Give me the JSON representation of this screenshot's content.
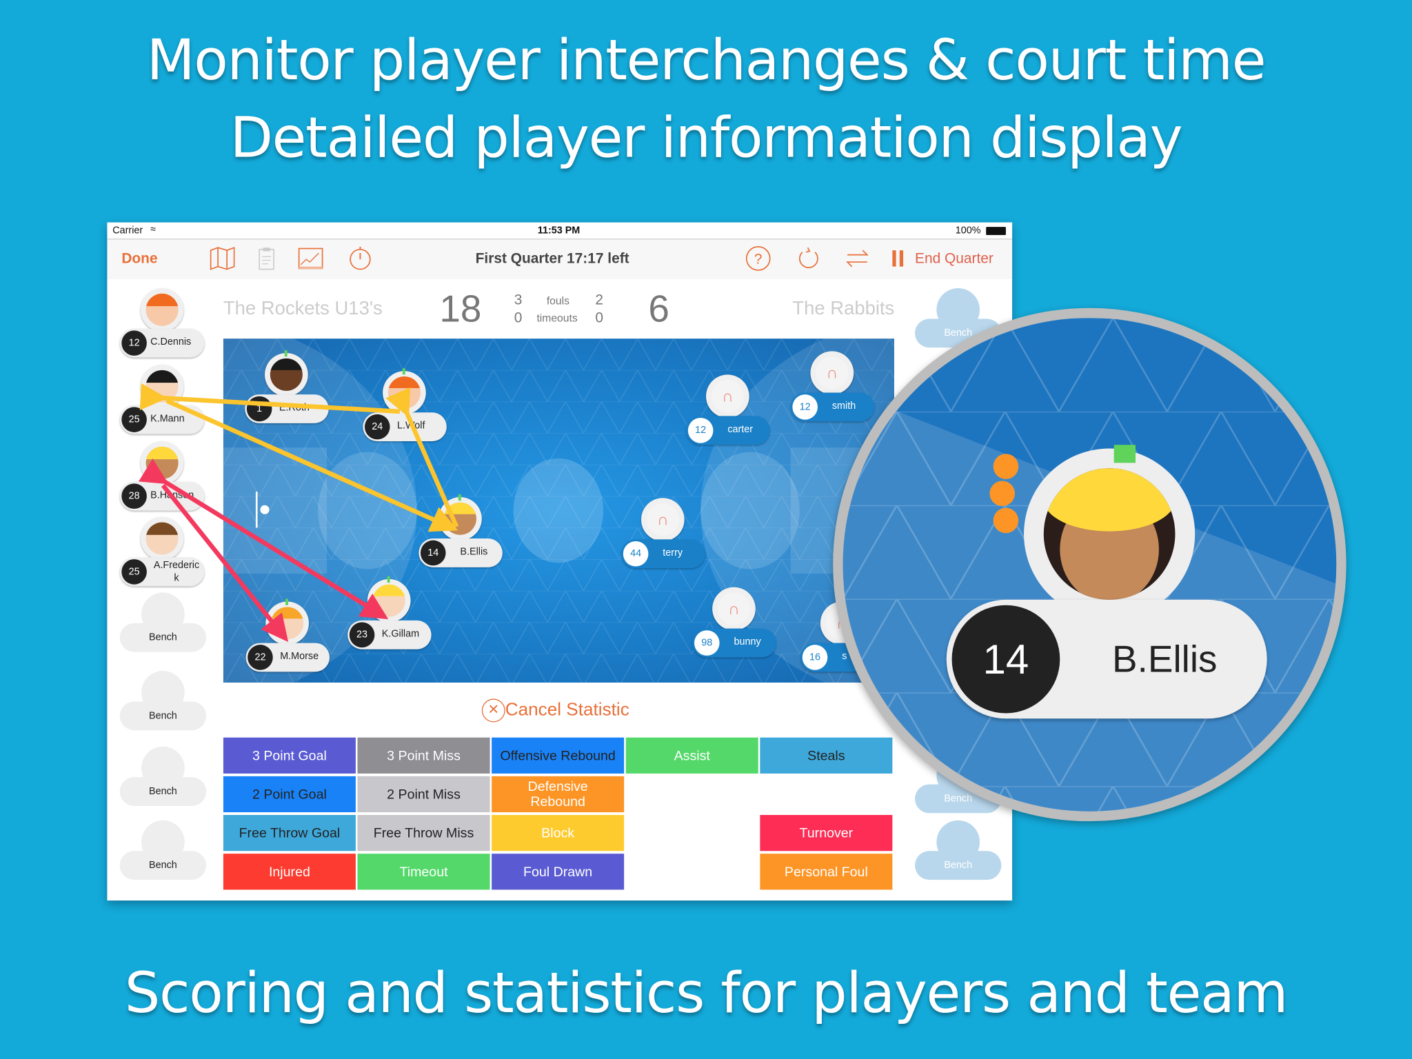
{
  "headline": {
    "line1": "Monitor player interchanges & court time",
    "line2": "Detailed player information display",
    "footer": "Scoring and statistics for players and team"
  },
  "status_bar": {
    "carrier": "Carrier",
    "time": "11:53 PM",
    "battery": "100%"
  },
  "toolbar": {
    "done": "Done",
    "title": "First Quarter  17:17 left",
    "end_quarter": "End Quarter",
    "icons": [
      "map-icon",
      "clipboard-icon",
      "chart-icon",
      "stopwatch-icon",
      "help-icon",
      "refresh-icon",
      "swap-icon",
      "pause-icon"
    ],
    "accent": "#e8703a"
  },
  "scoreboard": {
    "home_team": "The Rockets U13's",
    "home_score": "18",
    "home_fouls": "3",
    "home_timeouts": "0",
    "fouls_label": "fouls",
    "timeouts_label": "timeouts",
    "away_fouls": "2",
    "away_timeouts": "0",
    "away_score": "6",
    "away_team": "The Rabbits"
  },
  "home_bench": [
    {
      "number": "12",
      "name": "C.Dennis"
    },
    {
      "number": "25",
      "name": "K.Mann"
    },
    {
      "number": "28",
      "name": "B.Hansen"
    },
    {
      "number": "25",
      "name": "A.Frederic k"
    },
    {
      "name": "Bench"
    },
    {
      "name": "Bench"
    },
    {
      "name": "Bench"
    },
    {
      "name": "Bench"
    }
  ],
  "away_bench": [
    {
      "name": "Bench"
    },
    {
      "name": "Bench"
    },
    {
      "name": "Bench"
    }
  ],
  "home_court": [
    {
      "number": "1",
      "name": "E.Roth"
    },
    {
      "number": "24",
      "name": "L.Wolf"
    },
    {
      "number": "14",
      "name": "B.Ellis"
    },
    {
      "number": "23",
      "name": "K.Gillam"
    },
    {
      "number": "22",
      "name": "M.Morse"
    }
  ],
  "away_court": [
    {
      "number": "12",
      "name": "carter"
    },
    {
      "number": "12",
      "name": "smith"
    },
    {
      "number": "44",
      "name": "terry"
    },
    {
      "number": "98",
      "name": "bunny"
    },
    {
      "number": "16",
      "name": "s"
    }
  ],
  "cancel_statistic": "Cancel Statistic",
  "stat_buttons": [
    {
      "label": "3 Point Goal",
      "color": "#5a5bd3",
      "text": "#fff"
    },
    {
      "label": "3 Point Miss",
      "color": "#8e8e93",
      "text": "#fff"
    },
    {
      "label": "Offensive Rebound",
      "color": "#1a82f7",
      "text": "#222"
    },
    {
      "label": "Assist",
      "color": "#55d86a",
      "text": "#fff"
    },
    {
      "label": "Steals",
      "color": "#3ea8da",
      "text": "#222"
    },
    {
      "label": "2 Point Goal",
      "color": "#1a82f7",
      "text": "#222"
    },
    {
      "label": "2 Point Miss",
      "color": "#c7c7cc",
      "text": "#222"
    },
    {
      "label": "Defensive Rebound",
      "color": "#fd9526",
      "text": "#fff"
    },
    {
      "label": "Free Throw Goal",
      "color": "#3ea8da",
      "text": "#222"
    },
    {
      "label": "Free Throw Miss",
      "color": "#c7c7cc",
      "text": "#222"
    },
    {
      "label": "Block",
      "color": "#fecb2f",
      "text": "#fff"
    },
    {
      "label": "Turnover",
      "color": "#fe2d55",
      "text": "#fff"
    },
    {
      "label": "Injured",
      "color": "#fd3b30",
      "text": "#fff"
    },
    {
      "label": "Timeout",
      "color": "#55d86a",
      "text": "#fff"
    },
    {
      "label": "Foul Drawn",
      "color": "#5a5bd3",
      "text": "#fff"
    },
    {
      "label": "Personal Foul",
      "color": "#fd9526",
      "text": "#fff"
    }
  ],
  "magnifier": {
    "number": "14",
    "name": "B.Ellis"
  }
}
